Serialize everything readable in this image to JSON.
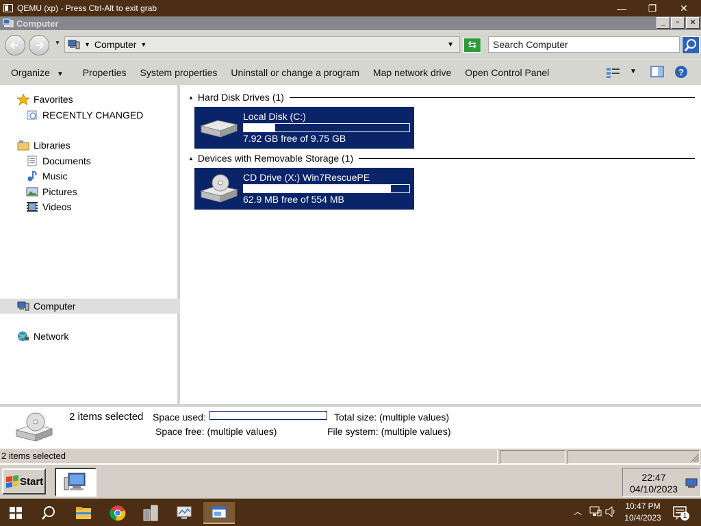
{
  "host": {
    "title": "QEMU (xp) - Press Ctrl-Alt to exit grab",
    "minimize": "—",
    "restore": "❐",
    "close": "✕",
    "taskbar": {
      "time": "10:47 PM",
      "date": "10/4/2023",
      "notification_count": "1",
      "icons": [
        "windows-start-icon",
        "search-icon",
        "file-explorer-icon",
        "chrome-icon",
        "qemu-app-icon",
        "monitor-app-icon",
        "explorer-window-icon",
        "chevron-up-icon",
        "network-icon",
        "volume-icon",
        "notification-icon"
      ]
    }
  },
  "window": {
    "title": "Computer",
    "controls": {
      "minimize": "_",
      "restore": "▫",
      "close": "✕"
    }
  },
  "address": {
    "crumb": "Computer",
    "search_placeholder": "Search Computer"
  },
  "toolbar": {
    "organize": "Organize",
    "properties": "Properties",
    "system_properties": "System properties",
    "uninstall": "Uninstall or change a program",
    "map_drive": "Map network drive",
    "control_panel": "Open Control Panel"
  },
  "nav": {
    "favorites": "Favorites",
    "recently_changed": "RECENTLY CHANGED",
    "libraries": "Libraries",
    "documents": "Documents",
    "music": "Music",
    "pictures": "Pictures",
    "videos": "Videos",
    "computer": "Computer",
    "network": "Network"
  },
  "content": {
    "groups": [
      {
        "header": "Hard Disk Drives (1)",
        "drive": {
          "name": "Local Disk (C:)",
          "free_text": "7.92 GB free of 9.75 GB",
          "used_fraction": 0.19
        }
      },
      {
        "header": "Devices with Removable Storage (1)",
        "drive": {
          "name": "CD Drive (X:) Win7RescuePE",
          "free_text": "62.9 MB free of 554 MB",
          "used_fraction": 0.89
        }
      }
    ]
  },
  "details": {
    "count": "2 items selected",
    "space_used_label": "Space used:",
    "space_free_label": "Space free:",
    "space_free_value": "(multiple values)",
    "total_size_label": "Total size:",
    "total_size_value": "(multiple values)",
    "file_system_label": "File system:",
    "file_system_value": "(multiple values)"
  },
  "status": {
    "text": "2 items selected"
  },
  "guest_taskbar": {
    "start": "Start",
    "time": "22:47",
    "date": "04/10/2023"
  },
  "colors": {
    "selection_blue": "#0a246a",
    "host_taskbar": "#4b2e13",
    "chrome_gray": "#d6d6d0"
  }
}
